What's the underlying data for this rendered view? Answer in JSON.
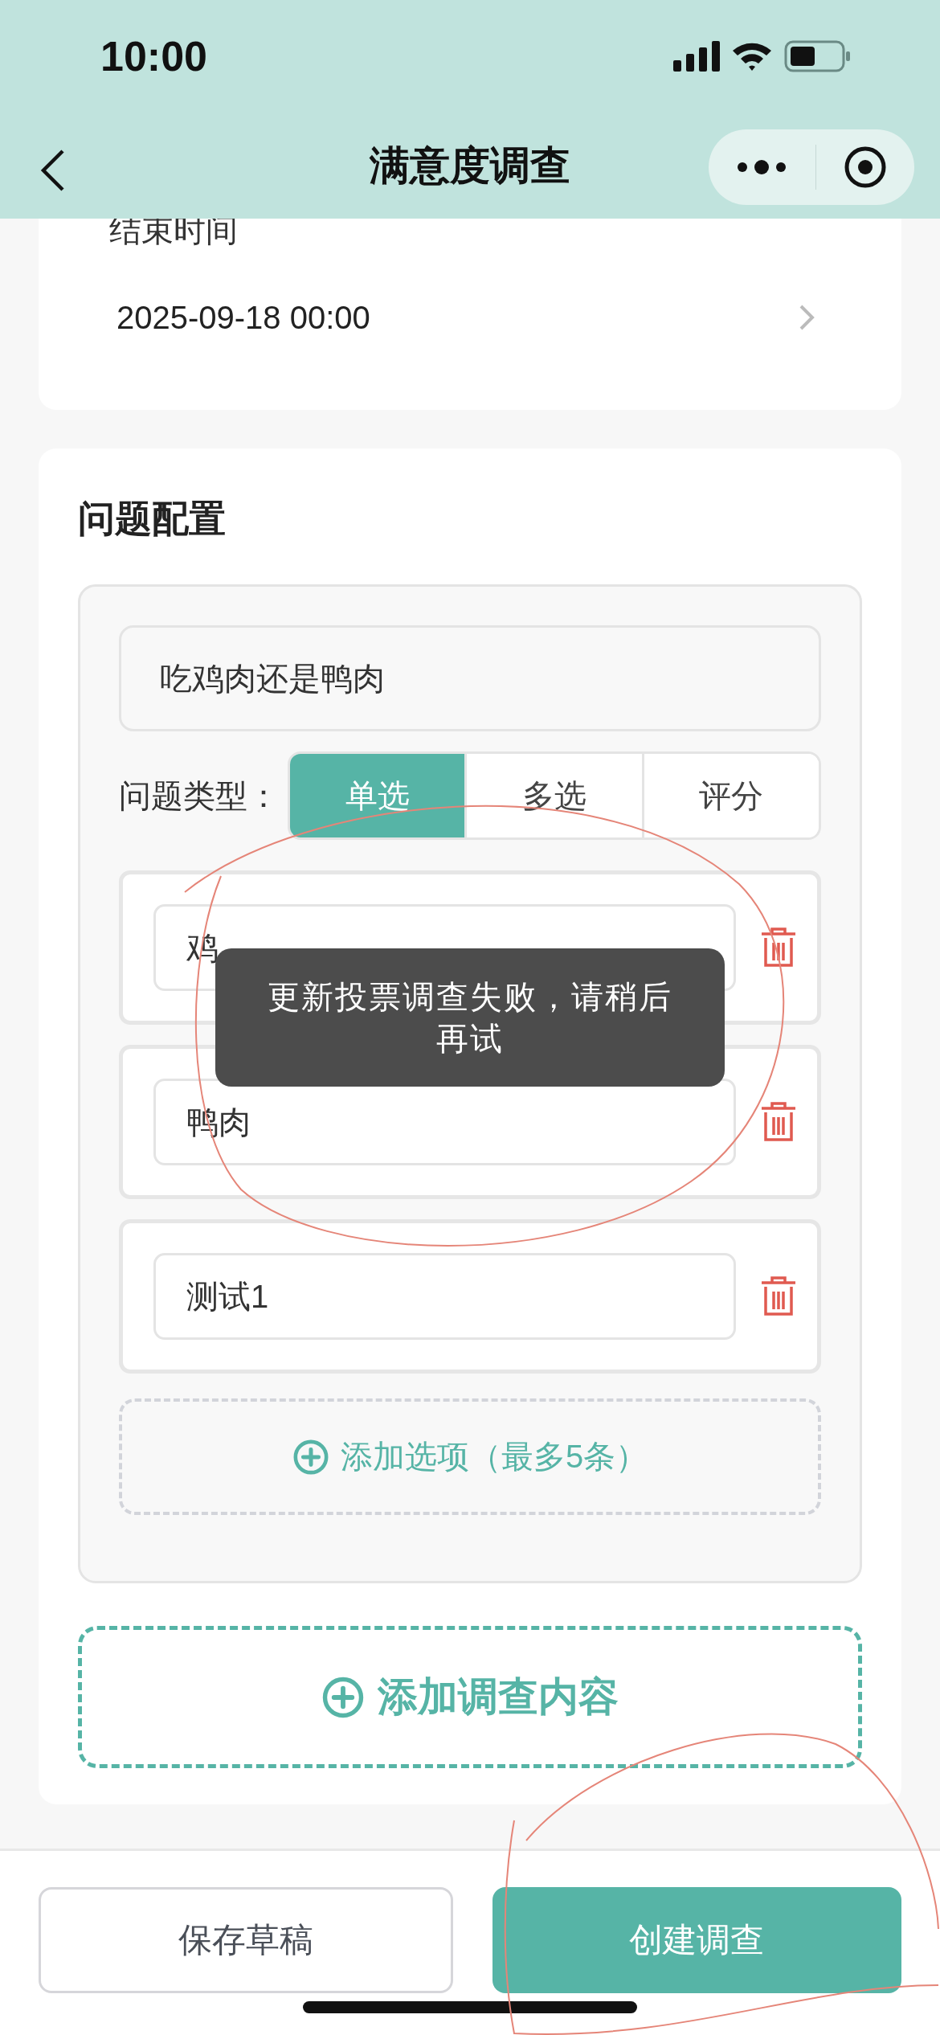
{
  "status_bar": {
    "time": "10:00"
  },
  "nav": {
    "title": "满意度调查"
  },
  "end_time": {
    "label": "结束时间",
    "value": "2025-09-18 00:00"
  },
  "question_config": {
    "title": "问题配置",
    "questions": [
      {
        "text": "吃鸡肉还是鸭肉",
        "type_label": "问题类型：",
        "types": [
          {
            "label": "单选",
            "selected": true
          },
          {
            "label": "多选",
            "selected": false
          },
          {
            "label": "评分",
            "selected": false
          }
        ],
        "options": [
          {
            "text": "鸡"
          },
          {
            "text": "鸭肉"
          },
          {
            "text": "测试1"
          }
        ],
        "add_option": "添加选项（最多5条）"
      }
    ],
    "add_content": "添加调查内容"
  },
  "toast": "更新投票调查失败，请稍后再试",
  "buttons": [
    {
      "label": "保存草稿",
      "kind": "secondary"
    },
    {
      "label": "创建调查",
      "kind": "primary"
    }
  ]
}
